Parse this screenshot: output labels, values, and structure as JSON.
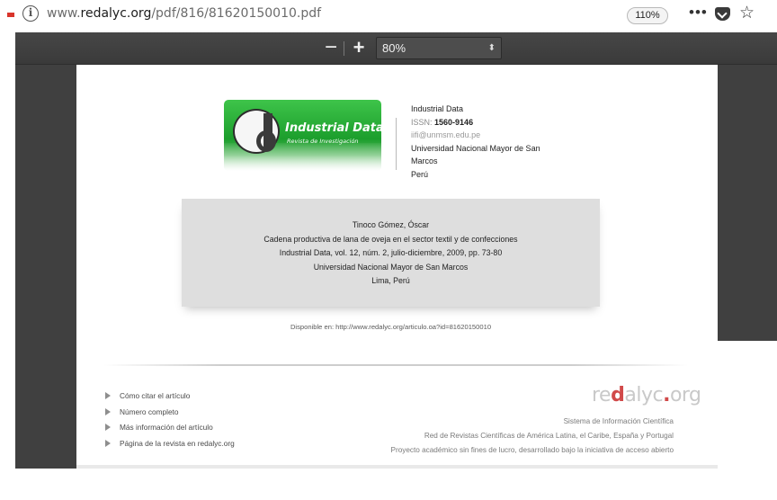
{
  "browser": {
    "url_prefix": "www.",
    "url_domain": "redalyc.org",
    "url_path": "/pdf/816/81620150010.pdf",
    "zoom": "110%",
    "menu_dots": "•••",
    "info_icon": "i",
    "star_glyph": "☆"
  },
  "pdf_toolbar": {
    "zoom_out": "−",
    "zoom_in": "+",
    "zoom_value": "80%",
    "zoom_arrows": "⬍"
  },
  "journal_logo": {
    "title": "Industrial Data",
    "subtitle": "Revista de Investigación"
  },
  "journal_info": {
    "name": "Industrial Data",
    "issn_label": "ISSN:",
    "issn": "1560-9146",
    "email": "iifi@unmsm.edu.pe",
    "university_line1": "Universidad Nacional Mayor de San",
    "university_line2": "Marcos",
    "country": "Perú"
  },
  "citation": {
    "author": "Tinoco Gómez, Óscar",
    "title": "Cadena productiva de lana de oveja en el sector textil y de confecciones",
    "source": "Industrial Data, vol. 12, núm. 2, julio-diciembre, 2009, pp. 73-80",
    "institution": "Universidad Nacional Mayor de San Marcos",
    "location": "Lima, Perú"
  },
  "available": "Disponible en: http://www.redalyc.org/articulo.oa?id=81620150010",
  "links": [
    "Cómo citar el artículo",
    "Número completo",
    "Más información del artículo",
    "Página de la revista en redalyc.org"
  ],
  "redalyc": {
    "logo_start": "re",
    "logo_accent": "d",
    "logo_mid": "alyc",
    "logo_accent2": ".",
    "logo_end": "org",
    "line1": "Sistema de Información Científica",
    "line2": "Red de Revistas Científicas de América Latina, el Caribe, España y Portugal",
    "line3": "Proyecto académico sin fines de lucro, desarrollado bajo la iniciativa de acceso abierto"
  }
}
